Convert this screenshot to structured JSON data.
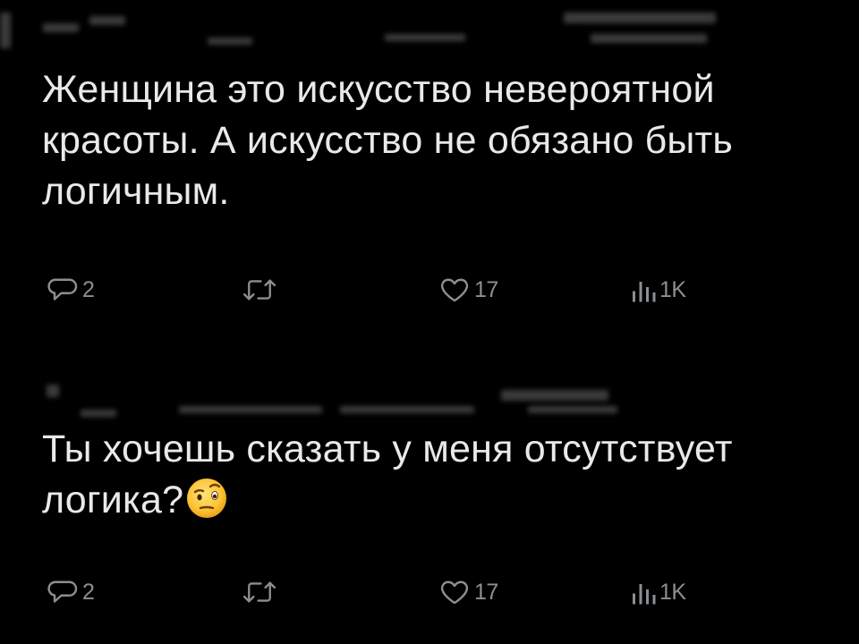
{
  "posts": [
    {
      "text": "Женщина это искусство невероятной красоты. А искусство не обязано быть логичным.",
      "actions": {
        "replies": "2",
        "likes": "17",
        "views": "1K"
      }
    },
    {
      "text": "Ты хочешь сказать у меня отсутствует логика?",
      "emoji": "raised-eyebrow-face",
      "actions": {
        "replies": "2",
        "likes": "17",
        "views": "1K"
      }
    }
  ],
  "icons": {
    "reply": "reply-bubble-icon",
    "retweet": "retweet-icon",
    "like": "heart-icon",
    "views": "views-bar-chart-icon"
  },
  "colors": {
    "background": "#000000",
    "text": "#e7e9ea",
    "secondary": "#8b8f94"
  }
}
